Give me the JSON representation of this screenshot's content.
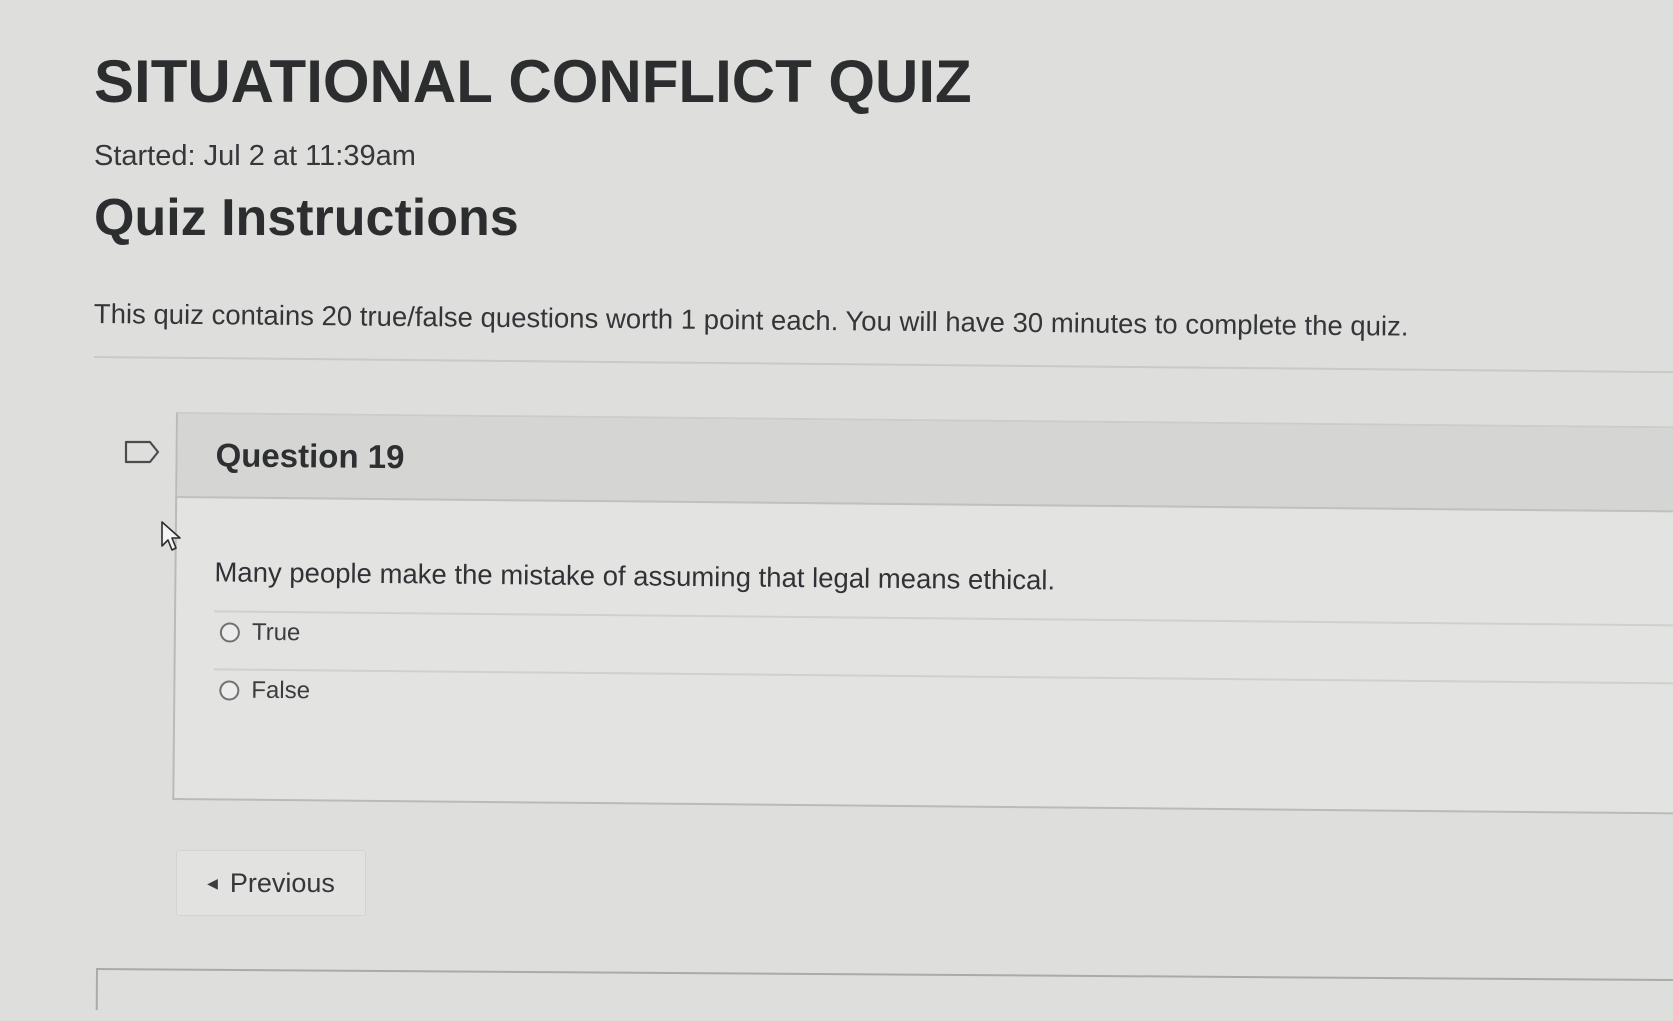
{
  "quiz": {
    "title": "SITUATIONAL CONFLICT QUIZ",
    "started": "Started: Jul 2 at 11:39am",
    "instructions_heading": "Quiz Instructions",
    "instructions_text": "This quiz contains 20 true/false questions worth 1 point each. You will have 30 minutes to complete the quiz."
  },
  "question": {
    "number_label": "Question 19",
    "text": "Many people make the mistake of assuming that legal means ethical.",
    "answers": [
      {
        "label": "True",
        "selected": false
      },
      {
        "label": "False",
        "selected": false
      }
    ],
    "flagged": false
  },
  "navigation": {
    "previous_label": "Previous"
  },
  "icons": {
    "flag": "flag-outline-icon",
    "cursor": "mouse-pointer-icon",
    "previous": "caret-left-icon"
  }
}
